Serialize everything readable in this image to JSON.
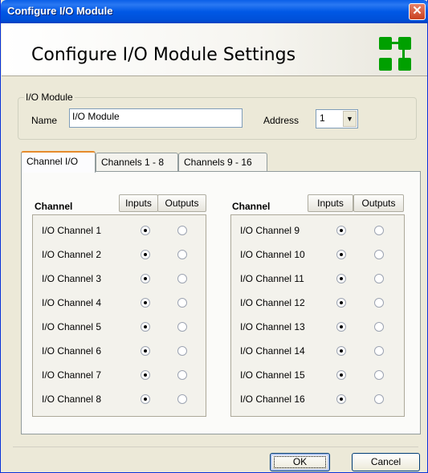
{
  "window": {
    "title": "Configure I/O Module",
    "close_label": "✕"
  },
  "header": {
    "heading": "Configure I/O Module Settings",
    "logo_icon": "network-nodes-icon"
  },
  "module_group": {
    "legend": "I/O Module",
    "name_label": "Name",
    "name_value": "I/O Module",
    "address_label": "Address",
    "address_value": "1"
  },
  "tabs": [
    {
      "label": "Channel I/O",
      "active": true
    },
    {
      "label": "Channels 1 - 8",
      "active": false
    },
    {
      "label": "Channels 9 - 16",
      "active": false
    }
  ],
  "channel_io": {
    "left": {
      "header": "Channel",
      "inputs_label": "Inputs",
      "outputs_label": "Outputs",
      "rows": [
        {
          "name": "I/O Channel 1",
          "mode": "input"
        },
        {
          "name": "I/O Channel 2",
          "mode": "input"
        },
        {
          "name": "I/O Channel 3",
          "mode": "input"
        },
        {
          "name": "I/O Channel 4",
          "mode": "input"
        },
        {
          "name": "I/O Channel 5",
          "mode": "input"
        },
        {
          "name": "I/O Channel 6",
          "mode": "input"
        },
        {
          "name": "I/O Channel 7",
          "mode": "input"
        },
        {
          "name": "I/O Channel 8",
          "mode": "input"
        }
      ]
    },
    "right": {
      "header": "Channel",
      "inputs_label": "Inputs",
      "outputs_label": "Outputs",
      "rows": [
        {
          "name": "I/O Channel 9",
          "mode": "input"
        },
        {
          "name": "I/O Channel 10",
          "mode": "input"
        },
        {
          "name": "I/O Channel 11",
          "mode": "input"
        },
        {
          "name": "I/O Channel 12",
          "mode": "input"
        },
        {
          "name": "I/O Channel 13",
          "mode": "input"
        },
        {
          "name": "I/O Channel 14",
          "mode": "input"
        },
        {
          "name": "I/O Channel 15",
          "mode": "input"
        },
        {
          "name": "I/O Channel 16",
          "mode": "input"
        }
      ]
    }
  },
  "footer": {
    "ok_label": "OK",
    "cancel_label": "Cancel"
  },
  "colors": {
    "titlebar": "#0058e6",
    "dialog_bg": "#ece9d8",
    "logo_green": "#00a000",
    "tab_highlight": "#e68b2c"
  }
}
